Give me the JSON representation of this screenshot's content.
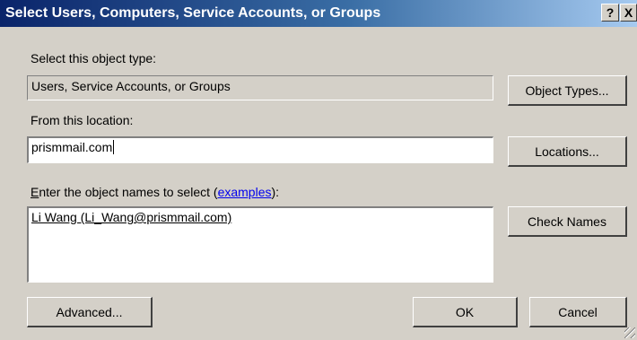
{
  "window": {
    "title": "Select Users, Computers, Service Accounts, or Groups",
    "help_label": "?",
    "close_label": "X"
  },
  "object_type": {
    "label": "Select this object type:",
    "value": "Users, Service Accounts, or Groups",
    "button": "Object Types..."
  },
  "location": {
    "label": "From this location:",
    "value": "prismmail.com",
    "button": "Locations..."
  },
  "names": {
    "label_accel": "E",
    "label_rest": "nter the object names to select (",
    "examples_link": "examples",
    "label_end": "):",
    "value": "Li Wang (Li_Wang@prismmail.com)",
    "check_button": "Check Names"
  },
  "buttons": {
    "advanced": "Advanced...",
    "ok": "OK",
    "cancel": "Cancel"
  }
}
